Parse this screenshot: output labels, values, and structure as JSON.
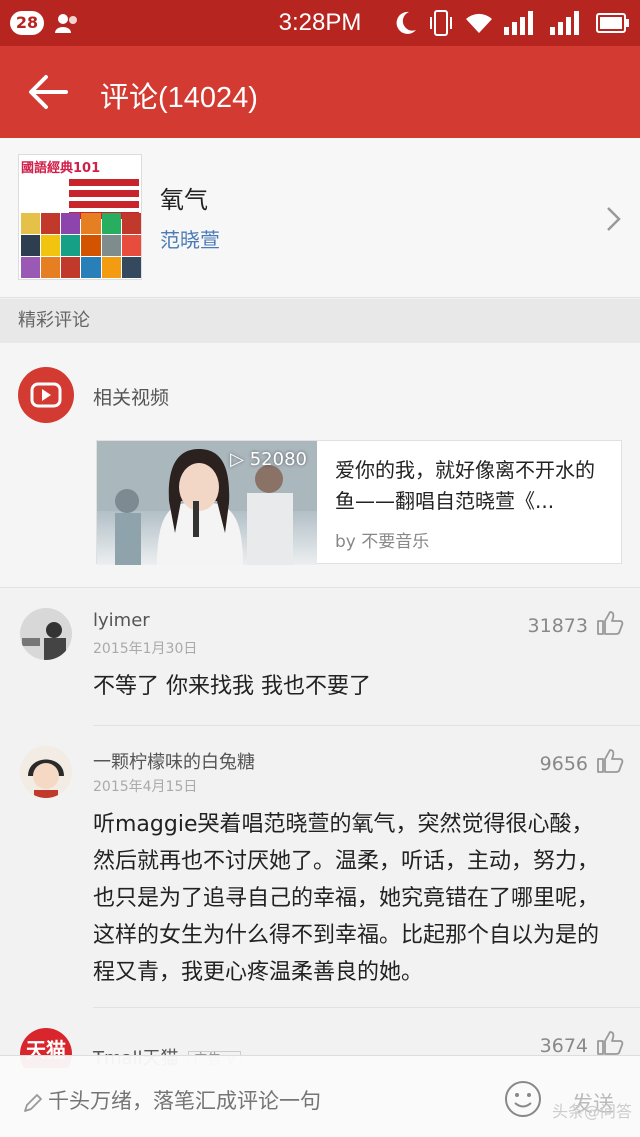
{
  "status_bar": {
    "badge": "28",
    "time": "3:28PM"
  },
  "app_bar": {
    "title": "评论(14024)"
  },
  "song": {
    "album_header": "國語經典101",
    "title": "氧气",
    "artist": "范晓萱"
  },
  "section": {
    "label": "精彩评论"
  },
  "related_video": {
    "label": "相关视频",
    "play_count": "52080",
    "title": "爱你的我，就好像离不开水的鱼——翻唱自范晓萱《...",
    "by": "by 不要音乐"
  },
  "comments": [
    {
      "user": "lyimer",
      "date": "2015年1月30日",
      "likes": "31873",
      "text": "不等了 你来找我 我也不要了"
    },
    {
      "user": "一颗柠檬味的白兔糖",
      "date": "2015年4月15日",
      "likes": "9656",
      "text": "听maggie哭着唱范晓萱的氧气，突然觉得很心酸，然后就再也不讨厌她了。温柔，听话，主动，努力，也只是为了追寻自己的幸福，她究竟错在了哪里呢，这样的女生为什么得不到幸福。比起那个自以为是的程又青，我更心疼温柔善良的她。"
    },
    {
      "user": "Tmall天猫",
      "avatar_text": "天猫",
      "tag": "广告",
      "likes": "3674"
    }
  ],
  "input": {
    "placeholder": "千头万绪，落笔汇成评论一句",
    "send": "发送"
  },
  "watermark": "头条@问答",
  "colors": {
    "status_bar": "#b72521",
    "app_bar": "#d33a31",
    "accent_red": "#d33a31",
    "artist_link": "#4a7ab8"
  },
  "icons": {
    "back": "arrow-left-icon",
    "video": "youtube-play-icon",
    "like": "thumb-up-icon",
    "chevron": "chevron-right-icon",
    "emoji": "smiley-icon",
    "pen": "pen-icon"
  }
}
